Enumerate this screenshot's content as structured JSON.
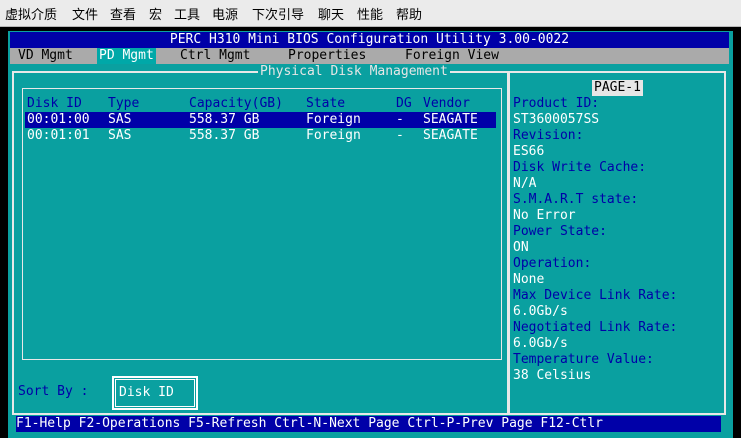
{
  "menubar": {
    "items": [
      "虚拟介质",
      "文件",
      "查看",
      "宏",
      "工具",
      "电源",
      "下次引导",
      "聊天",
      "性能",
      "帮助"
    ]
  },
  "bios": {
    "title": "PERC H310 Mini BIOS Configuration Utility 3.00-0022",
    "tabs": [
      "VD Mgmt",
      "PD Mgmt",
      "Ctrl Mgmt",
      "Properties",
      "Foreign View"
    ],
    "active_tab": "PD Mgmt",
    "section_title": "Physical Disk Management",
    "columns": [
      "Disk ID",
      "Type",
      "Capacity(GB)",
      "State",
      "DG",
      "Vendor"
    ],
    "disks": [
      {
        "id": "00:01:00",
        "type": "SAS",
        "capacity": "558.37 GB",
        "state": "Foreign",
        "dg": "-",
        "vendor": "SEAGATE"
      },
      {
        "id": "00:01:01",
        "type": "SAS",
        "capacity": "558.37 GB",
        "state": "Foreign",
        "dg": "-",
        "vendor": "SEAGATE"
      }
    ],
    "selected_row": 0,
    "sort_by_label": "Sort By :",
    "sort_by_value": "Disk ID"
  },
  "details": {
    "page": "PAGE-1",
    "product_id_label": "Product ID:",
    "product_id": "ST3600057SS",
    "revision_label": "Revision:",
    "revision": "ES66",
    "write_cache_label": "Disk Write Cache:",
    "write_cache": "N/A",
    "smart_label": "S.M.A.R.T state:",
    "smart": "No Error",
    "power_label": "Power State:",
    "power": "ON",
    "operation_label": "Operation:",
    "operation": "None",
    "max_link_label": "Max Device Link Rate:",
    "max_link": "6.0Gb/s",
    "neg_link_label": "Negotiated Link Rate:",
    "neg_link": "6.0Gb/s",
    "temp_label": "Temperature Value:",
    "temp": "38 Celsius"
  },
  "statusbar": {
    "text": "F1-Help F2-Operations F5-Refresh Ctrl-N-Next Page Ctrl-P-Prev Page F12-Ctlr"
  },
  "colors": {
    "bios_background": "#0aa0a0",
    "title_blue": "#0000a8",
    "tab_bar_gray": "#aaaaaa"
  }
}
